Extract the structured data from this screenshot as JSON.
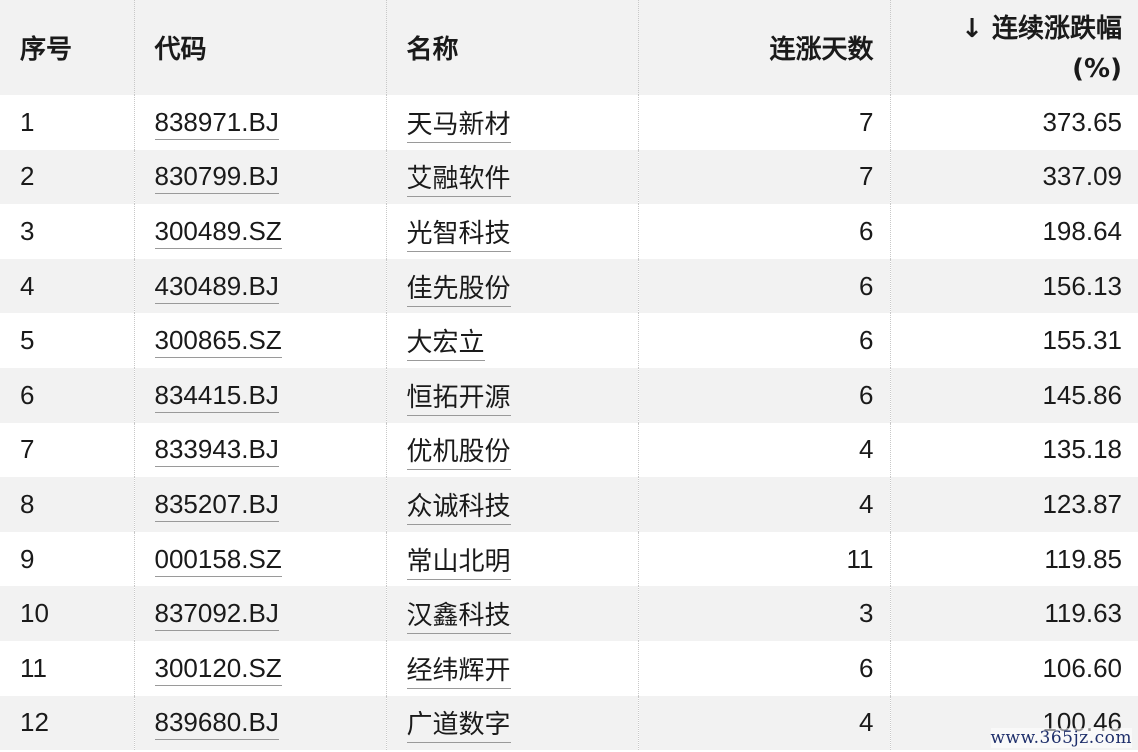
{
  "headers": {
    "index": "序号",
    "code": "代码",
    "name": "名称",
    "streak": "连涨天数",
    "change_line1": "↓ 连续涨跌幅",
    "change_line2": "(%)"
  },
  "rows": [
    {
      "index": "1",
      "code": "838971.BJ",
      "name": "天马新材",
      "streak": "7",
      "change": "373.65"
    },
    {
      "index": "2",
      "code": "830799.BJ",
      "name": "艾融软件",
      "streak": "7",
      "change": "337.09"
    },
    {
      "index": "3",
      "code": "300489.SZ",
      "name": "光智科技",
      "streak": "6",
      "change": "198.64"
    },
    {
      "index": "4",
      "code": "430489.BJ",
      "name": "佳先股份",
      "streak": "6",
      "change": "156.13"
    },
    {
      "index": "5",
      "code": "300865.SZ",
      "name": "大宏立",
      "streak": "6",
      "change": "155.31"
    },
    {
      "index": "6",
      "code": "834415.BJ",
      "name": "恒拓开源",
      "streak": "6",
      "change": "145.86"
    },
    {
      "index": "7",
      "code": "833943.BJ",
      "name": "优机股份",
      "streak": "4",
      "change": "135.18"
    },
    {
      "index": "8",
      "code": "835207.BJ",
      "name": "众诚科技",
      "streak": "4",
      "change": "123.87"
    },
    {
      "index": "9",
      "code": "000158.SZ",
      "name": "常山北明",
      "streak": "11",
      "change": "119.85"
    },
    {
      "index": "10",
      "code": "837092.BJ",
      "name": "汉鑫科技",
      "streak": "3",
      "change": "119.63"
    },
    {
      "index": "11",
      "code": "300120.SZ",
      "name": "经纬辉开",
      "streak": "6",
      "change": "106.60"
    },
    {
      "index": "12",
      "code": "839680.BJ",
      "name": "广道数字",
      "streak": "4",
      "change": "100.46"
    }
  ],
  "watermark": "www.365jz.com"
}
